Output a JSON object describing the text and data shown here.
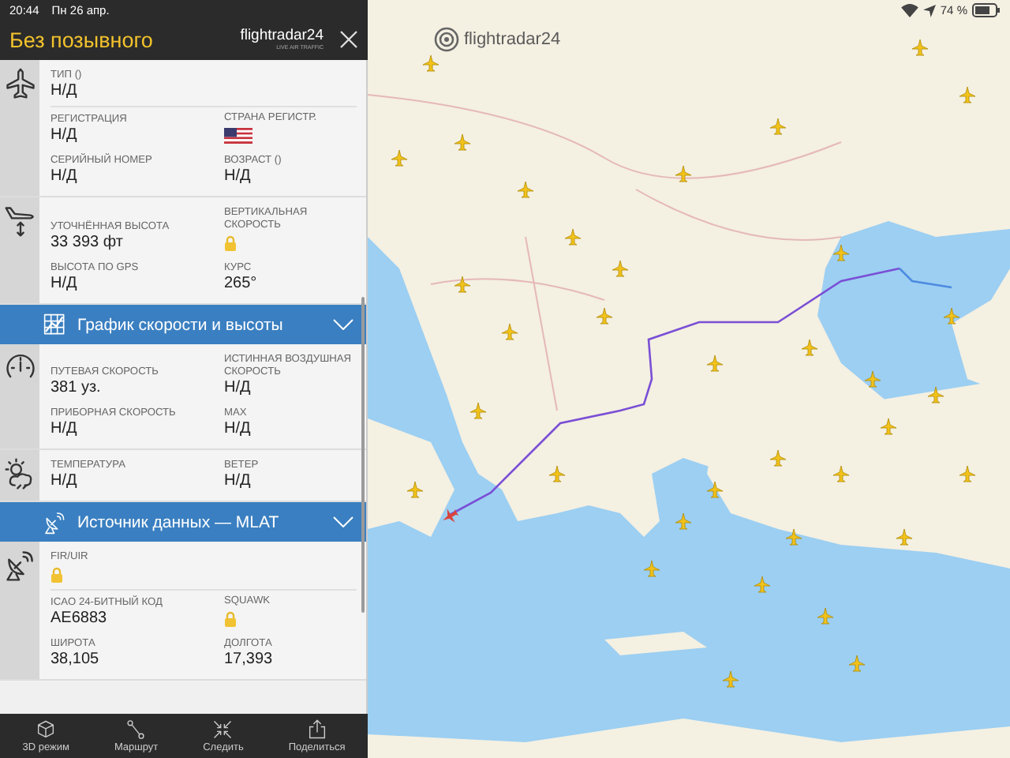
{
  "status_bar": {
    "time": "20:44",
    "date": "Пн 26 апр.",
    "battery": "74 %"
  },
  "header": {
    "title": "Без позывного",
    "logo": "flightradar24",
    "logo_tagline": "LIVE AIR TRAFFIC"
  },
  "panel": [
    {
      "kind": "section",
      "groups": [
        [
          [
            {
              "kind": "text",
              "label": "ТИП ()",
              "value": "Н/Д"
            }
          ]
        ],
        [
          [
            {
              "kind": "text",
              "label": "РЕГИСТРАЦИЯ",
              "value": "Н/Д"
            },
            {
              "kind": "flag",
              "label": "СТРАНА РЕГИСТР."
            }
          ],
          [
            {
              "kind": "text",
              "label": "СЕРИЙНЫЙ НОМЕР",
              "value": "Н/Д"
            },
            {
              "kind": "text",
              "label": "ВОЗРАСТ ()",
              "value": "Н/Д"
            }
          ]
        ]
      ]
    },
    {
      "kind": "section",
      "groups": [
        [
          [
            {
              "kind": "text",
              "label": "УТОЧНЁННАЯ ВЫСОТА",
              "value": "33 393 фт"
            },
            {
              "kind": "lock",
              "label": "ВЕРТИКАЛЬНАЯ СКОРОСТЬ"
            }
          ],
          [
            {
              "kind": "text",
              "label": "ВЫСОТА ПО GPS",
              "value": "Н/Д"
            },
            {
              "kind": "text",
              "label": "КУРС",
              "value": "265°"
            }
          ]
        ]
      ]
    },
    {
      "kind": "bar",
      "label": "График скорости и высоты"
    },
    {
      "kind": "section",
      "groups": [
        [
          [
            {
              "kind": "text",
              "label": "ПУТЕВАЯ СКОРОСТЬ",
              "value": "381 уз."
            },
            {
              "kind": "text",
              "label": "ИСТИННАЯ ВОЗДУШНАЯ СКОРОСТЬ",
              "value": "Н/Д"
            }
          ],
          [
            {
              "kind": "text",
              "label": "ПРИБОРНАЯ СКОРОСТЬ",
              "value": "Н/Д"
            },
            {
              "kind": "text",
              "label": "MAX",
              "value": "Н/Д"
            }
          ]
        ]
      ]
    },
    {
      "kind": "section",
      "groups": [
        [
          [
            {
              "kind": "text",
              "label": "ТЕМПЕРАТУРА",
              "value": "Н/Д"
            },
            {
              "kind": "text",
              "label": "ВЕТЕР",
              "value": "Н/Д"
            }
          ]
        ]
      ]
    },
    {
      "kind": "bar",
      "label": "Источник данных — MLAT"
    },
    {
      "kind": "section",
      "groups": [
        [
          [
            {
              "kind": "lock",
              "label": "FIR/UIR"
            }
          ]
        ],
        [
          [
            {
              "kind": "text",
              "label": "ICAO 24-БИТНЫЙ КОД",
              "value": "AE6883"
            },
            {
              "kind": "lock",
              "label": "SQUAWK"
            }
          ],
          [
            {
              "kind": "text",
              "label": "ШИРОТА",
              "value": "38,105"
            },
            {
              "kind": "text",
              "label": "ДОЛГОТА",
              "value": "17,393"
            }
          ]
        ]
      ]
    }
  ],
  "toolbar": [
    {
      "label": "3D режим"
    },
    {
      "label": "Маршрут"
    },
    {
      "label": "Следить"
    },
    {
      "label": "Поделиться"
    }
  ],
  "map": {
    "logo": "flightradar24"
  }
}
